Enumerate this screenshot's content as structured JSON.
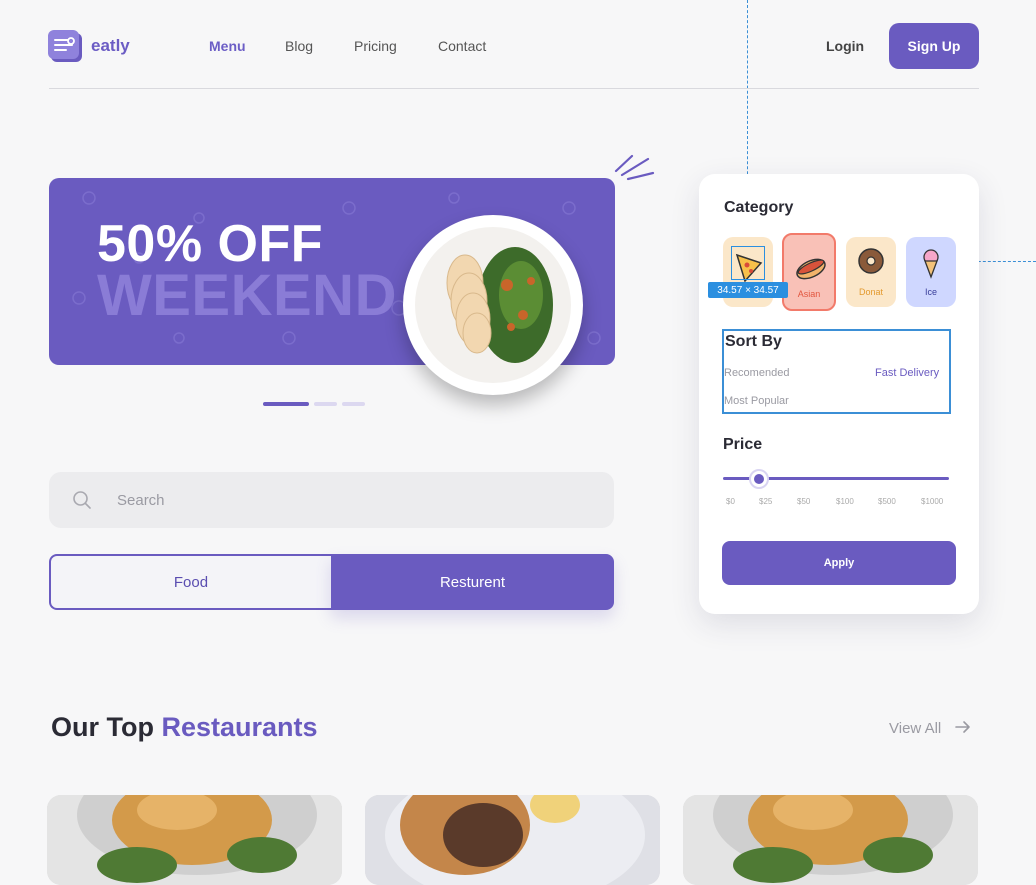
{
  "header": {
    "logo": "eatly",
    "nav": [
      "Menu",
      "Blog",
      "Pricing",
      "Contact"
    ],
    "active_nav": "Menu",
    "login": "Login",
    "signup": "Sign Up"
  },
  "banner": {
    "title": "50% OFF",
    "subtitle": "WEEKEND",
    "slide_count": 3,
    "active_slide": 1
  },
  "search": {
    "placeholder": "Search"
  },
  "toggle": {
    "food": "Food",
    "restaurant": "Resturent",
    "selected": "Resturent"
  },
  "filter": {
    "category_title": "Category",
    "categories": [
      {
        "label": "",
        "icon": "pizza-icon",
        "color": "#fbe7c9"
      },
      {
        "label": "Asian",
        "icon": "hotdog-icon",
        "color": "#f9c1b7",
        "selected": true
      },
      {
        "label": "Donat",
        "icon": "donut-icon",
        "color": "#fbe7c9"
      },
      {
        "label": "Ice",
        "icon": "ice-cream-icon",
        "color": "#cfd7ff"
      }
    ],
    "sort_title": "Sort By",
    "sort_options": [
      "Recomended",
      "Fast Delivery",
      "Most Popular"
    ],
    "price_title": "Price",
    "price_ticks": [
      "$0",
      "$25",
      "$50",
      "$100",
      "$500",
      "$1000"
    ],
    "price_value": "$25",
    "apply": "Apply",
    "measure_label": "34.57 × 34.57"
  },
  "restaurants": {
    "title_plain": "Our Top",
    "title_highlight": "Restaurants",
    "view_all": "View All",
    "cards": [
      {
        "image": "roast-chicken-photo"
      },
      {
        "image": "burger-photo"
      },
      {
        "image": "roast-chicken-photo"
      }
    ]
  },
  "colors": {
    "accent": "#6a5bc0",
    "selection": "#3b8fd6"
  }
}
